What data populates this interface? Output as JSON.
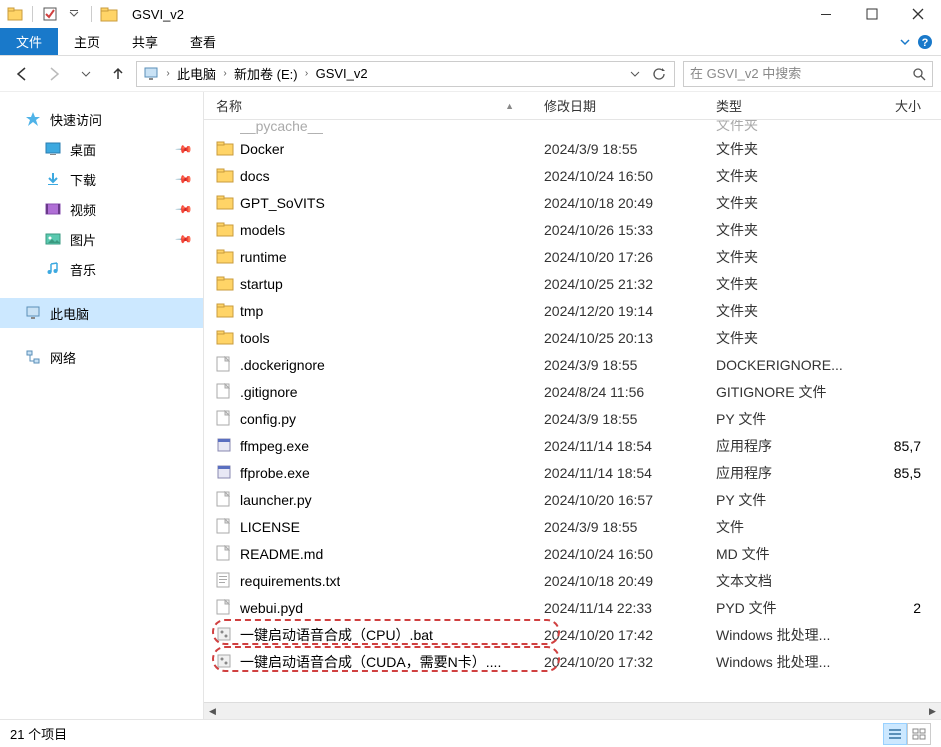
{
  "title": "GSVI_v2",
  "ribbon": {
    "file": "文件",
    "home": "主页",
    "share": "共享",
    "view": "查看"
  },
  "breadcrumb": {
    "root": "此电脑",
    "volume": "新加卷 (E:)",
    "folder": "GSVI_v2"
  },
  "search": {
    "placeholder": "在 GSVI_v2 中搜索"
  },
  "sidebar": {
    "quick_access": "快速访问",
    "desktop": "桌面",
    "downloads": "下载",
    "videos": "视频",
    "pictures": "图片",
    "music": "音乐",
    "this_pc": "此电脑",
    "network": "网络"
  },
  "columns": {
    "name": "名称",
    "date": "修改日期",
    "type": "类型",
    "size": "大小"
  },
  "partial_row": {
    "name": "__pycache__",
    "type": "文件夹"
  },
  "files": [
    {
      "icon": "folder",
      "name": "Docker",
      "date": "2024/3/9 18:55",
      "type": "文件夹",
      "size": ""
    },
    {
      "icon": "folder",
      "name": "docs",
      "date": "2024/10/24 16:50",
      "type": "文件夹",
      "size": ""
    },
    {
      "icon": "folder",
      "name": "GPT_SoVITS",
      "date": "2024/10/18 20:49",
      "type": "文件夹",
      "size": ""
    },
    {
      "icon": "folder",
      "name": "models",
      "date": "2024/10/26 15:33",
      "type": "文件夹",
      "size": ""
    },
    {
      "icon": "folder",
      "name": "runtime",
      "date": "2024/10/20 17:26",
      "type": "文件夹",
      "size": ""
    },
    {
      "icon": "folder",
      "name": "startup",
      "date": "2024/10/25 21:32",
      "type": "文件夹",
      "size": ""
    },
    {
      "icon": "folder",
      "name": "tmp",
      "date": "2024/12/20 19:14",
      "type": "文件夹",
      "size": ""
    },
    {
      "icon": "folder",
      "name": "tools",
      "date": "2024/10/25 20:13",
      "type": "文件夹",
      "size": ""
    },
    {
      "icon": "file",
      "name": ".dockerignore",
      "date": "2024/3/9 18:55",
      "type": "DOCKERIGNORE...",
      "size": ""
    },
    {
      "icon": "file",
      "name": ".gitignore",
      "date": "2024/8/24 11:56",
      "type": "GITIGNORE 文件",
      "size": ""
    },
    {
      "icon": "file",
      "name": "config.py",
      "date": "2024/3/9 18:55",
      "type": "PY 文件",
      "size": ""
    },
    {
      "icon": "exe",
      "name": "ffmpeg.exe",
      "date": "2024/11/14 18:54",
      "type": "应用程序",
      "size": "85,7"
    },
    {
      "icon": "exe",
      "name": "ffprobe.exe",
      "date": "2024/11/14 18:54",
      "type": "应用程序",
      "size": "85,5"
    },
    {
      "icon": "file",
      "name": "launcher.py",
      "date": "2024/10/20 16:57",
      "type": "PY 文件",
      "size": ""
    },
    {
      "icon": "file",
      "name": "LICENSE",
      "date": "2024/3/9 18:55",
      "type": "文件",
      "size": ""
    },
    {
      "icon": "file",
      "name": "README.md",
      "date": "2024/10/24 16:50",
      "type": "MD 文件",
      "size": ""
    },
    {
      "icon": "text",
      "name": "requirements.txt",
      "date": "2024/10/18 20:49",
      "type": "文本文档",
      "size": ""
    },
    {
      "icon": "file",
      "name": "webui.pyd",
      "date": "2024/11/14 22:33",
      "type": "PYD 文件",
      "size": "2"
    },
    {
      "icon": "bat",
      "name": "一键启动语音合成（CPU）.bat",
      "date": "2024/10/20 17:42",
      "type": "Windows 批处理...",
      "size": ""
    },
    {
      "icon": "bat",
      "name": "一键启动语音合成（CUDA，需要N卡）....",
      "date": "2024/10/20 17:32",
      "type": "Windows 批处理...",
      "size": ""
    }
  ],
  "status": {
    "item_count": "21 个项目"
  }
}
